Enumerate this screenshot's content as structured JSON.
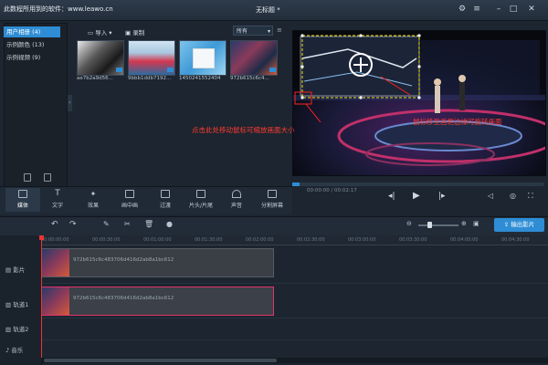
{
  "window": {
    "watermark": "此数程所用到的软件：www.leawo.cn",
    "title": "无标题 *"
  },
  "media_panel": {
    "categories": [
      "用户相册 (4)",
      "示例颜色 (13)",
      "示例视频 (9)"
    ],
    "import_label": "导入",
    "record_label": "录制",
    "sort_value": "所有",
    "thumbnails": [
      {
        "label": "ae7b2a9d56..."
      },
      {
        "label": "9bbb1ddb7192..."
      },
      {
        "label": "1450241552404"
      },
      {
        "label": "972b615c6c4..."
      }
    ]
  },
  "preview": {
    "timecode": "00:00:00 / 00:02:17",
    "annotation_left": "点击此处移动鼠标可缩放画面大小",
    "annotation_right": "鼠标移至画框边缘可旋转画面"
  },
  "function_tabs": [
    {
      "label": "媒体",
      "icon": "media-icon"
    },
    {
      "label": "文字",
      "icon": "text-icon"
    },
    {
      "label": "效果",
      "icon": "effects-icon"
    },
    {
      "label": "画中画",
      "icon": "pip-icon"
    },
    {
      "label": "过渡",
      "icon": "transition-icon"
    },
    {
      "label": "片头/片尾",
      "icon": "intro-icon"
    },
    {
      "label": "声音",
      "icon": "audio-icon"
    },
    {
      "label": "分割屏幕",
      "icon": "split-screen-icon"
    }
  ],
  "timeline": {
    "export_label": "输出影片",
    "ruler": [
      "00:00:00:00",
      "00:00:30:00",
      "00:01:00:00",
      "00:01:30:00",
      "00:02:00:00",
      "00:02:30:00",
      "00:03:00:00",
      "00:03:30:00",
      "00:04:00:00",
      "00:04:30:00"
    ],
    "tracks": [
      "影片",
      "轨道1",
      "轨道2",
      "音乐"
    ],
    "clip_label": "972b615c6c483706d416d2ab8a1bc612"
  },
  "colors": {
    "accent": "#2e8dd4",
    "annotation": "#ff3b2f",
    "selected_clip_border": "#e0336a"
  }
}
